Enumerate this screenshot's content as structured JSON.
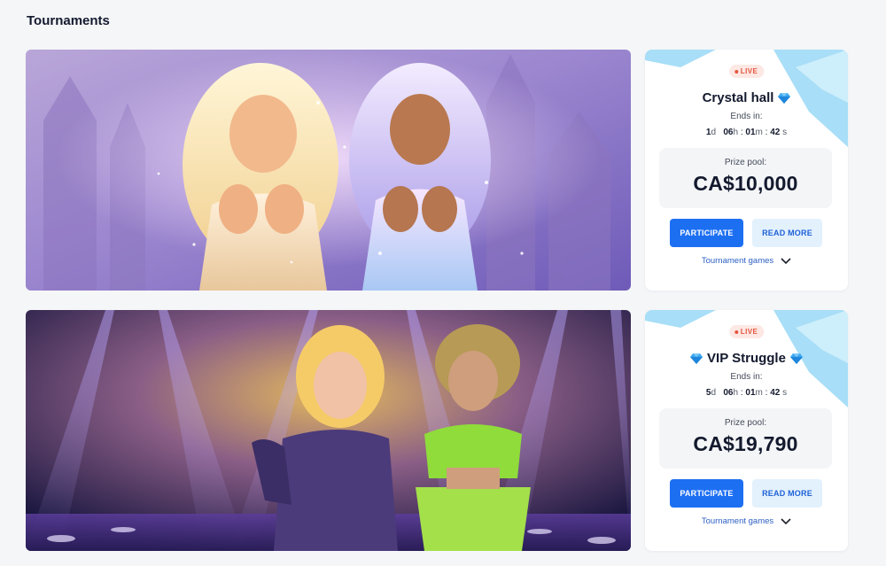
{
  "page": {
    "title": "Tournaments"
  },
  "tournaments": [
    {
      "badge": "LIVE",
      "name": "Crystal hall",
      "ends_label": "Ends in:",
      "timer": {
        "d": "1",
        "h": "06",
        "m": "01",
        "s": "42",
        "d_unit": "d",
        "h_unit": "h",
        "m_unit": "m",
        "s_unit": "s"
      },
      "prize_label": "Prize pool:",
      "prize_amount": "CA$10,000",
      "participate_label": "PARTICIPATE",
      "read_more_label": "READ MORE",
      "games_label": "Tournament games"
    },
    {
      "badge": "LIVE",
      "name": "VIP Struggle",
      "ends_label": "Ends in:",
      "timer": {
        "d": "5",
        "h": "06",
        "m": "01",
        "s": "42",
        "d_unit": "d",
        "h_unit": "h",
        "m_unit": "m",
        "s_unit": "s"
      },
      "prize_label": "Prize pool:",
      "prize_amount": "CA$19,790",
      "participate_label": "PARTICIPATE",
      "read_more_label": "READ MORE",
      "games_label": "Tournament games"
    }
  ],
  "colors": {
    "accent": "#1d6ff2",
    "live": "#e4553d",
    "card_bg": "#ffffff",
    "page_bg": "#f5f6f8"
  },
  "icons": {
    "gem": "diamond-icon",
    "chevron": "chevron-down-icon"
  }
}
